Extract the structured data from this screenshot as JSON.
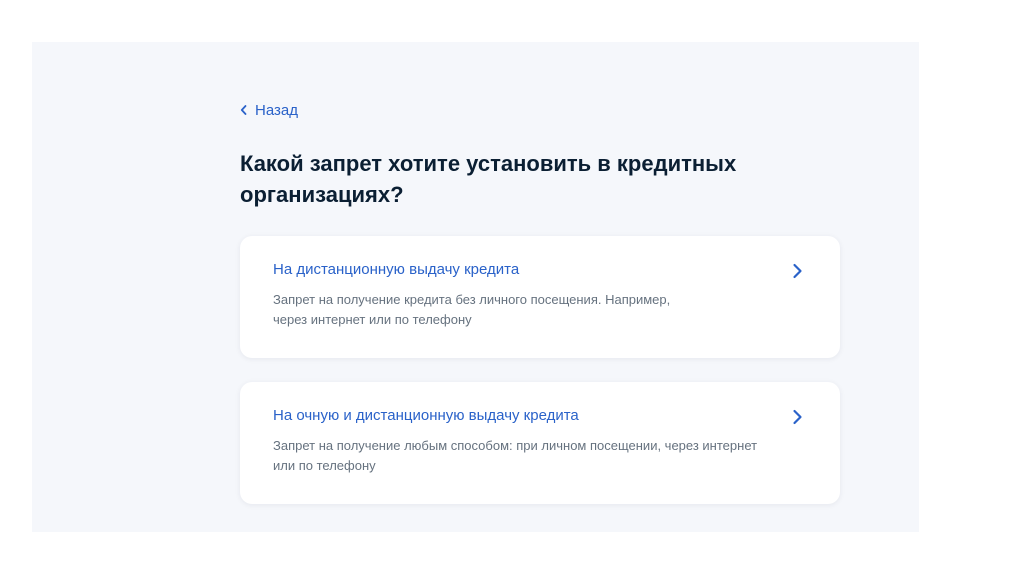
{
  "nav": {
    "back_label": "Назад"
  },
  "page": {
    "title_line1": "Какой запрет хотите установить в кредитных",
    "title_line2": "организациях?"
  },
  "options": [
    {
      "title": "На дистанционную выдачу кредита",
      "desc_line1": "Запрет на получение кредита без личного посещения. Например,",
      "desc_line2": "через интернет или по телефону",
      "icon": "chevron-right-icon"
    },
    {
      "title": "На очную и дистанционную выдачу кредита",
      "desc_line1": "Запрет на получение любым способом: при личном посещении, через интернет",
      "desc_line2": "или по телефону",
      "icon": "chevron-right-icon"
    }
  ],
  "colors": {
    "accent": "#2a62c9",
    "title": "#0b1f33",
    "muted": "#66727f",
    "panel_bg": "#f5f7fb",
    "card_bg": "#ffffff"
  }
}
